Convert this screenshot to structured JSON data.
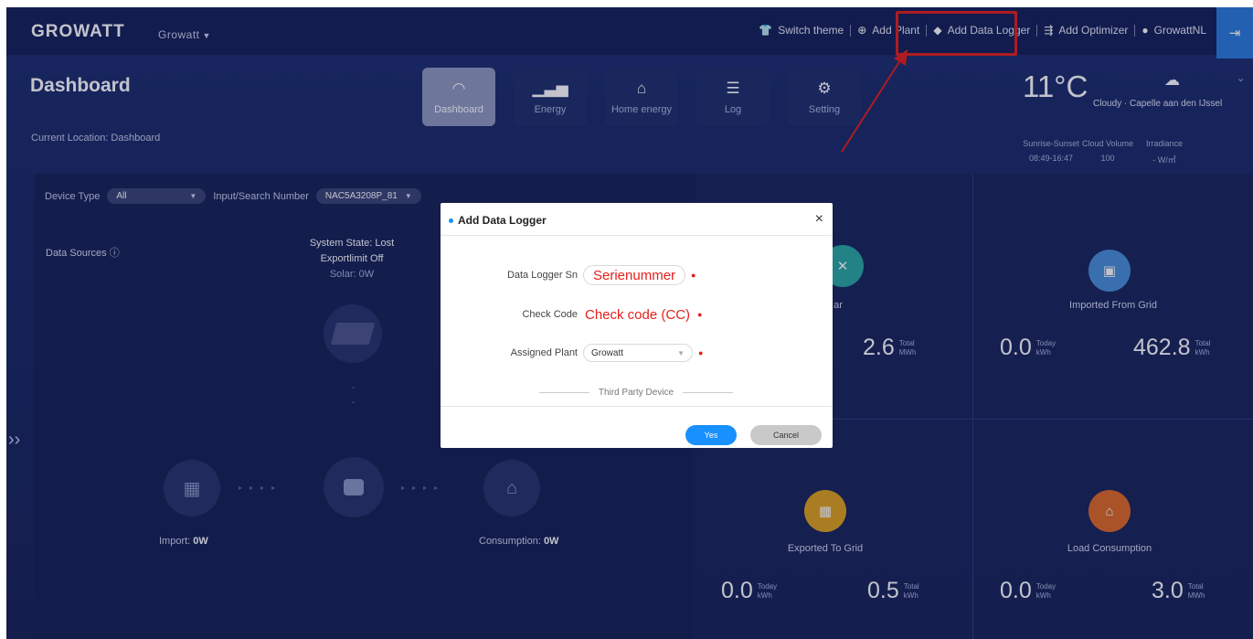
{
  "header": {
    "logo": "GROWATT",
    "account": "Growatt",
    "nav": [
      {
        "label": "Switch theme",
        "icon": "shirt-icon"
      },
      {
        "label": "Add Plant",
        "icon": "plus-circle-icon"
      },
      {
        "label": "Add Data Logger",
        "icon": "pin-icon"
      },
      {
        "label": "Add Optimizer",
        "icon": "optimizer-icon"
      },
      {
        "label": "GrowattNL",
        "icon": "user-icon"
      }
    ]
  },
  "page": {
    "title": "Dashboard",
    "location": "Current Location: Dashboard"
  },
  "tabs": [
    {
      "label": "Dashboard",
      "icon": "gauge-icon",
      "active": true
    },
    {
      "label": "Energy",
      "icon": "bar-chart-icon",
      "active": false
    },
    {
      "label": "Home energy",
      "icon": "home-icon",
      "active": false
    },
    {
      "label": "Log",
      "icon": "log-icon",
      "active": false
    },
    {
      "label": "Setting",
      "icon": "gear-icon",
      "active": false
    }
  ],
  "weather": {
    "temperature": "11°C",
    "description": "Cloudy · Capelle aan den IJssel",
    "items": [
      {
        "label": "Sunrise-Sunset",
        "value": "08:49-16:47"
      },
      {
        "label": "Cloud Volume",
        "value": "100"
      },
      {
        "label": "Irradiance",
        "value": "- W/㎡"
      }
    ]
  },
  "filters": {
    "device_type_label": "Device Type",
    "device_type_value": "All",
    "search_label": "Input/Search Number",
    "search_value": "NAC5A3208P_81"
  },
  "flow": {
    "data_sources": "Data Sources",
    "system_state": "System State: Lost",
    "export_limit": "Exportlimit Off",
    "solar": "Solar: 0W",
    "import_label": "Import: ",
    "import_value": "0W",
    "consumption_label": "Consumption: ",
    "consumption_value": "0W"
  },
  "stats": {
    "solar": {
      "title": "ar",
      "total": "2.6",
      "total_label": "Total",
      "total_unit": "MWh"
    },
    "imported": {
      "title": "Imported From Grid",
      "today": "0.0",
      "today_label": "Today",
      "today_unit": "kWh",
      "total": "462.8",
      "total_label": "Total",
      "total_unit": "kWh"
    },
    "exported": {
      "title": "Exported To Grid",
      "today": "0.0",
      "today_label": "Today",
      "today_unit": "kWh",
      "total": "0.5",
      "total_label": "Total",
      "total_unit": "kWh"
    },
    "load": {
      "title": "Load Consumption",
      "today": "0.0",
      "today_label": "Today",
      "today_unit": "kWh",
      "total": "3.0",
      "total_label": "Total",
      "total_unit": "MWh"
    }
  },
  "modal": {
    "title": "Add Data Logger",
    "sn_label": "Data Logger Sn",
    "sn_value": "Serienummer",
    "check_label": "Check Code",
    "check_value": "Check code (CC)",
    "plant_label": "Assigned Plant",
    "plant_value": "Growatt",
    "third_party": "Third Party Device",
    "yes": "Yes",
    "cancel": "Cancel"
  },
  "colors": {
    "highlight": "#e3201b",
    "primary": "#1890ff",
    "exit": "#2b7bdc",
    "solar_icon": "#2aa8a0",
    "grid_icon": "#4a8fd8",
    "export_icon": "#e0a21d",
    "load_icon": "#e06a24"
  }
}
